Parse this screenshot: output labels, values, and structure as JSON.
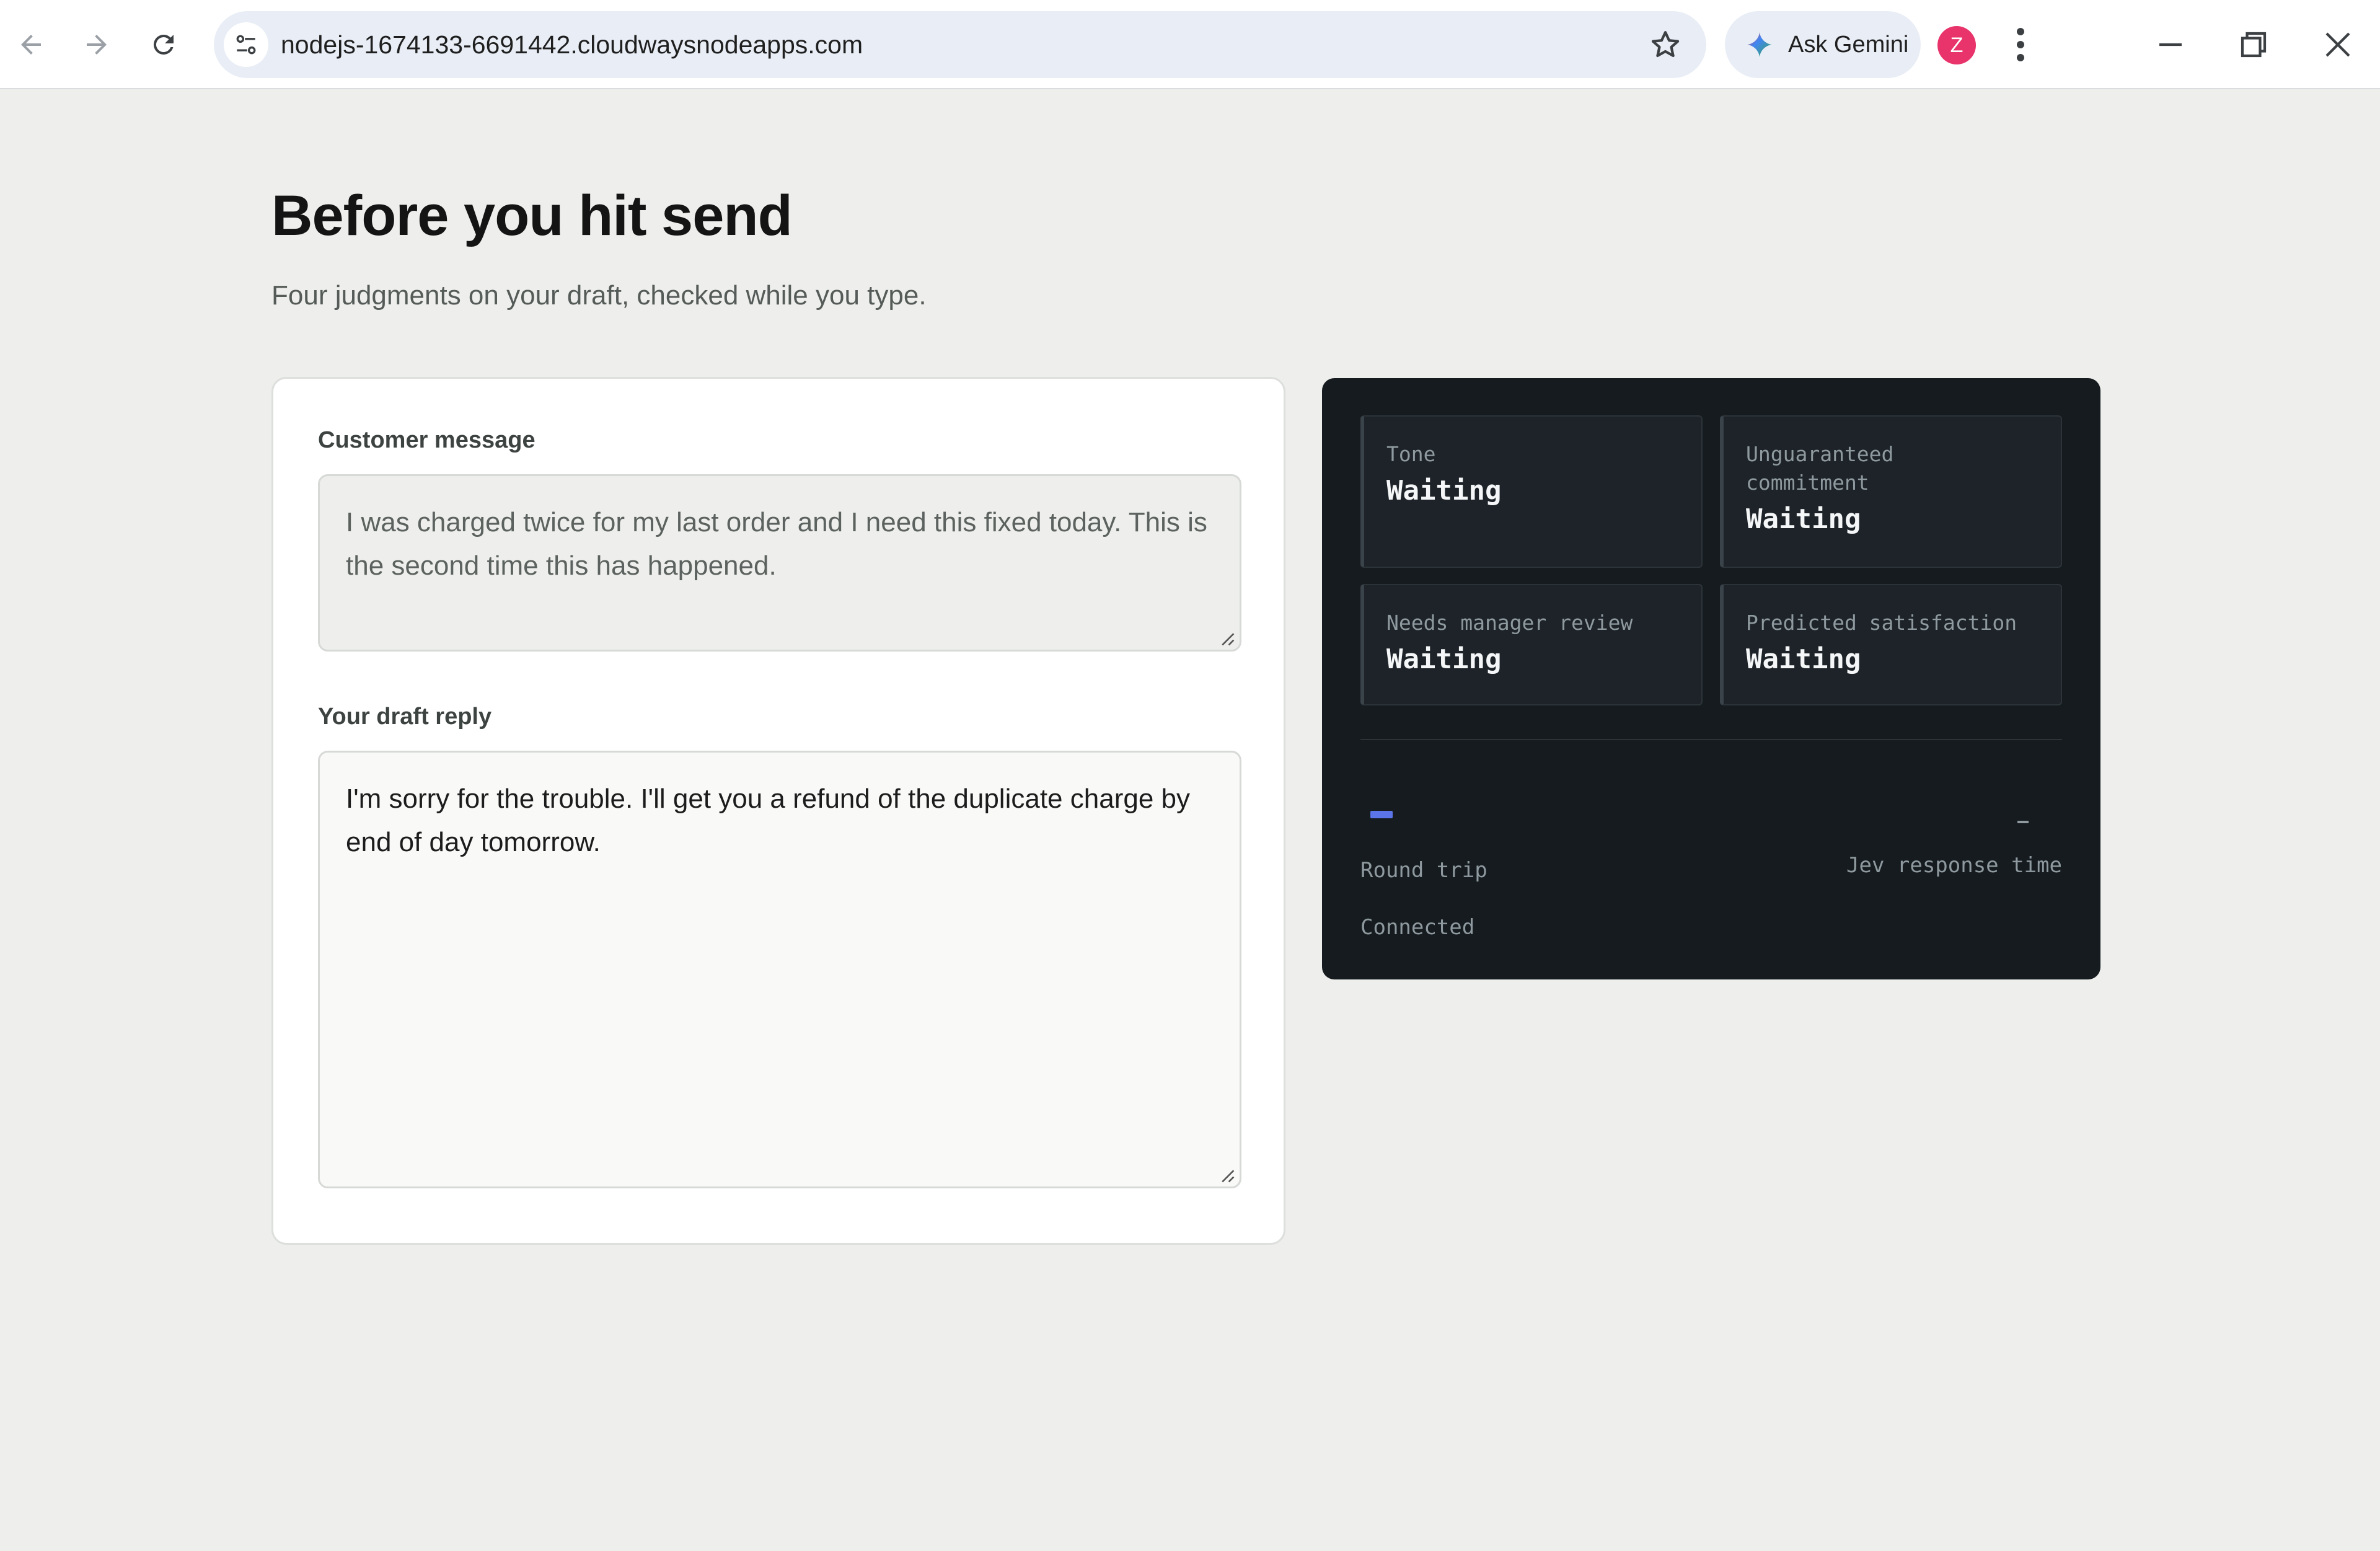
{
  "browser": {
    "url": "nodejs-1674133-6691442.cloudwaysnodeapps.com",
    "gemini_label": "Ask Gemini",
    "profile_initial": "Z"
  },
  "page": {
    "title": "Before you hit send",
    "subtitle": "Four judgments on your draft, checked while you type."
  },
  "form": {
    "customer_label": "Customer message",
    "customer_message": "I was charged twice for my last order and I need this fixed today. This is the second time this has happened.",
    "draft_label": "Your draft reply",
    "draft_reply": "I'm sorry for the trouble. I'll get you a refund of the duplicate charge by end of day tomorrow."
  },
  "judgments": [
    {
      "label": "Tone",
      "value": "Waiting"
    },
    {
      "label": "Unguaranteed commitment",
      "value": "Waiting"
    },
    {
      "label": "Needs manager review",
      "value": "Waiting"
    },
    {
      "label": "Predicted satisfaction",
      "value": "Waiting"
    }
  ],
  "metrics": {
    "round_trip_label": "Round trip",
    "response_time_label": "Jev response time",
    "status": "Connected"
  },
  "colors": {
    "accent": "#5b74e8",
    "panel_bg": "#161b1f",
    "page_bg": "#eeefec",
    "avatar": "#e8336b"
  }
}
